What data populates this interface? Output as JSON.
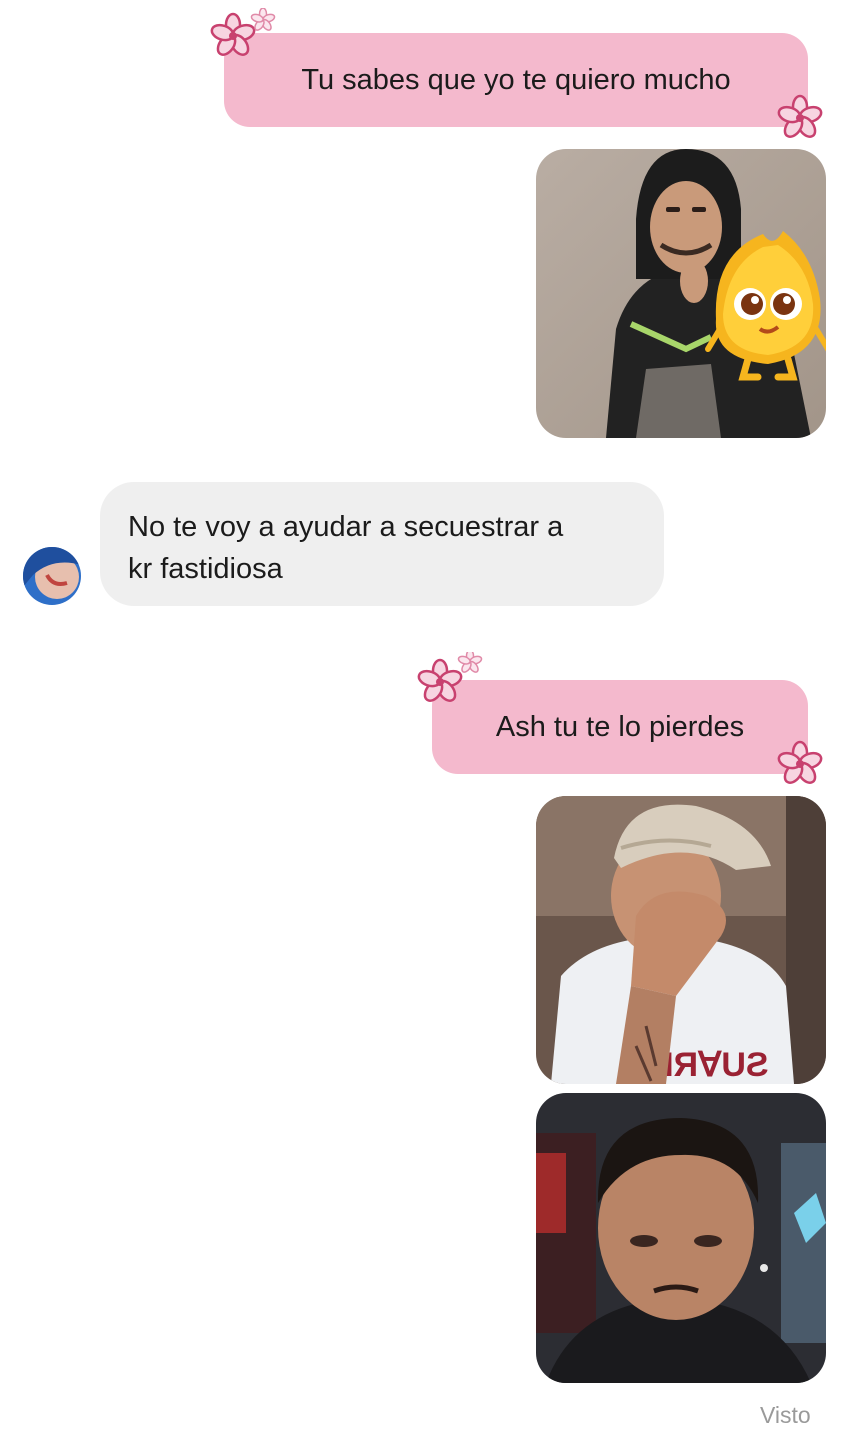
{
  "messages": {
    "m1": {
      "text": "Tu sabes que yo te quiero mucho",
      "direction": "outgoing"
    },
    "m2": {
      "direction": "outgoing",
      "type": "image",
      "content": "photo-with-sticker"
    },
    "m3": {
      "line1": "No te voy a ayudar a secuestrar a",
      "line2": "kr  fastidiosa",
      "direction": "incoming"
    },
    "m4": {
      "text": "Ash tu te lo pierdes",
      "direction": "outgoing"
    },
    "m5": {
      "direction": "outgoing",
      "type": "image",
      "content": "photo"
    },
    "m6": {
      "direction": "outgoing",
      "type": "image",
      "content": "photo"
    }
  },
  "status": {
    "seen_label": "Visto"
  },
  "colors": {
    "outgoing_bubble": "#f4b9cd",
    "incoming_bubble": "#efefef",
    "flower_accent": "#c8416f",
    "seen_text": "#9a9a9a"
  },
  "icons": [
    "flower-decoration-icon",
    "avatar"
  ]
}
